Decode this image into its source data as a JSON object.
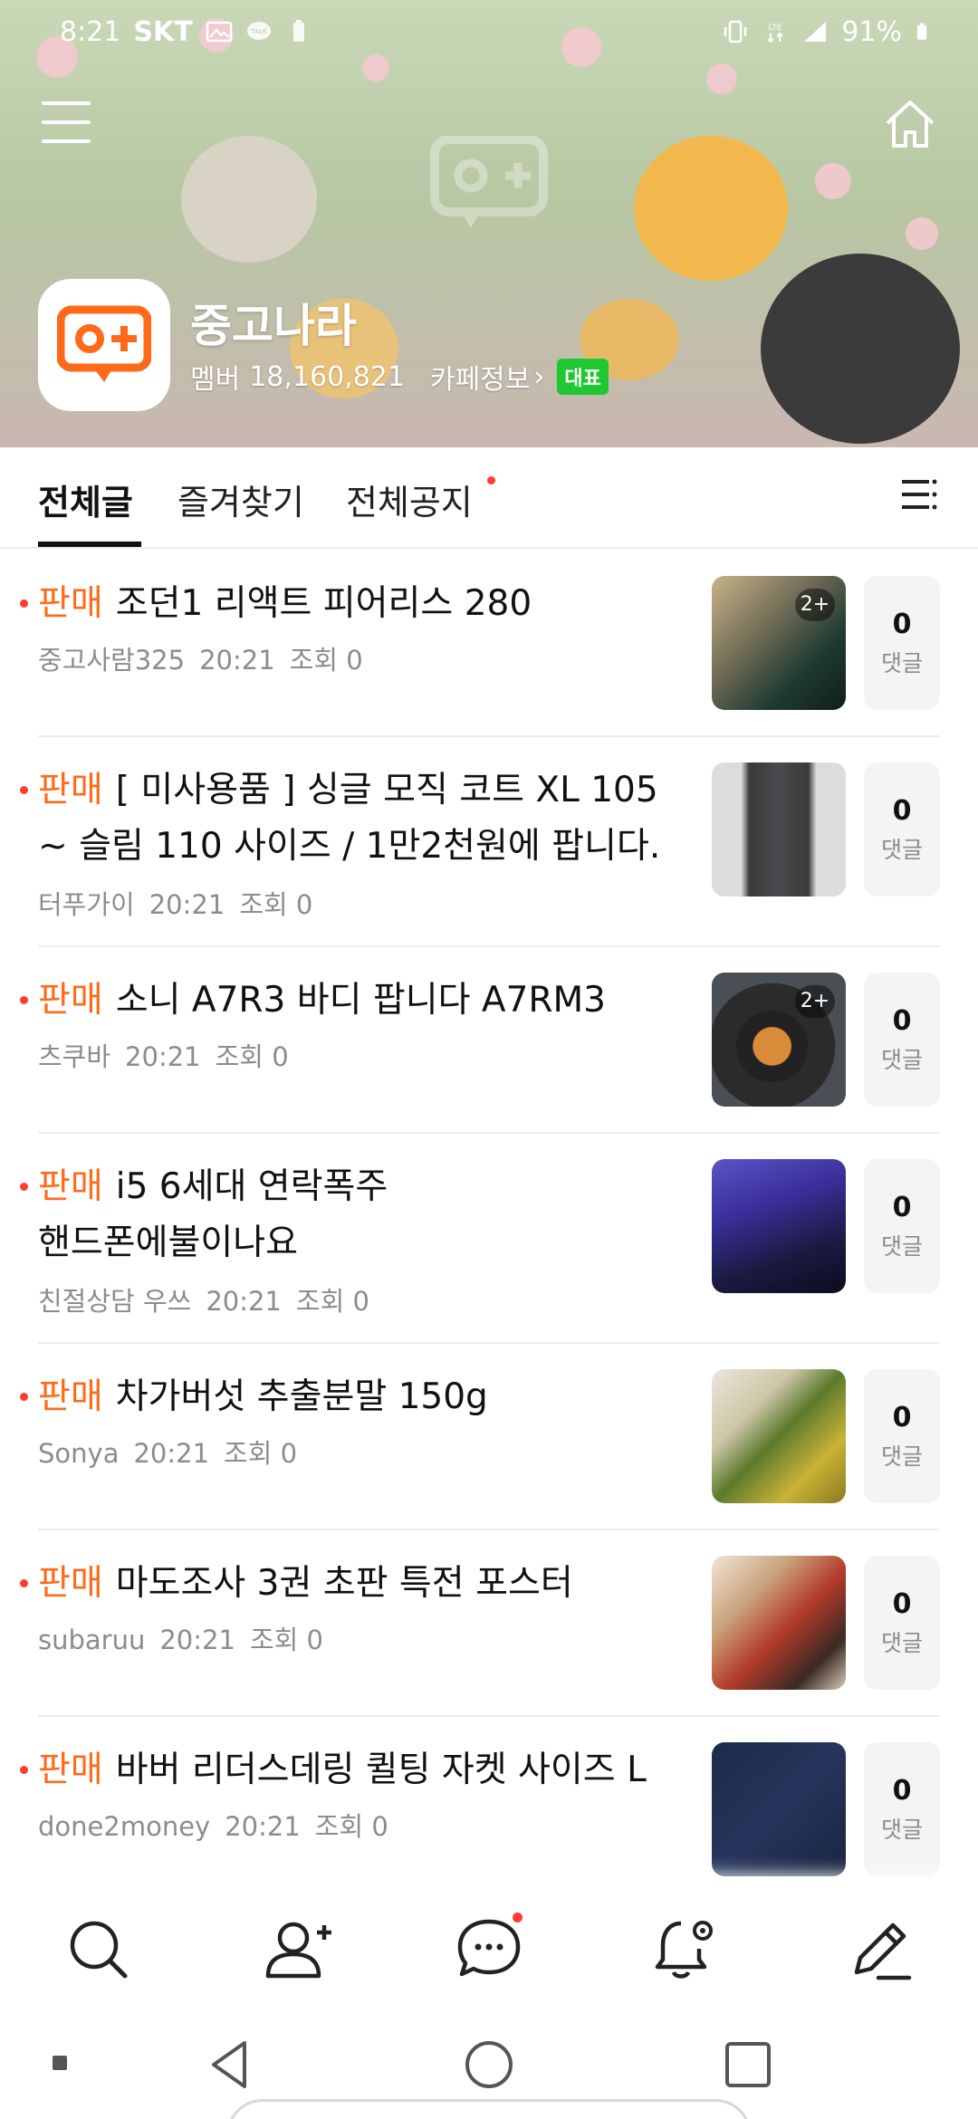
{
  "status_bar": {
    "time": "8:21",
    "carrier": "SKT",
    "battery": "91%",
    "network": "LTE",
    "talk_label": "TALK",
    "icons": [
      "gallery-icon",
      "kakaotalk-icon",
      "battery-saver-icon",
      "vibrate-icon",
      "lte-icon",
      "signal-icon",
      "battery-icon"
    ]
  },
  "header": {
    "menu_icon": "hamburger-menu-icon",
    "home_icon": "home-icon",
    "cafe_name": "중고나라",
    "member_label": "멤버",
    "member_count": "18,160,821",
    "cafe_info_label": "카페정보",
    "badge_label": "대표",
    "badge_color": "#1ec831",
    "accent_color": "#ff6a1a"
  },
  "tabs": {
    "items": [
      "전체글",
      "즐겨찾기",
      "전체공지"
    ],
    "active_index": 0,
    "list_icon": "list-view-icon"
  },
  "articles": [
    {
      "category": "판매",
      "title": "조던1 리액트 피어리스 280",
      "author": "중고사람325",
      "time": "20:21",
      "views": "조회 0",
      "image_badge": "2+",
      "comments": "0",
      "comment_label": "댓글"
    },
    {
      "category": "판매",
      "title": "[ 미사용품 ] 싱글 모직 코트 XL 105 ~ 슬림 110 사이즈 / 1만2천원에 팝니다.",
      "author": "터푸가이",
      "time": "20:21",
      "views": "조회 0",
      "image_badge": "",
      "comments": "0",
      "comment_label": "댓글"
    },
    {
      "category": "판매",
      "title": "소니 A7R3 바디 팝니다 A7RM3",
      "author": "츠쿠바",
      "time": "20:21",
      "views": "조회 0",
      "image_badge": "2+",
      "comments": "0",
      "comment_label": "댓글"
    },
    {
      "category": "판매",
      "title_line1": "i5 6세대 연락폭주",
      "title_line2": "핸드폰에불이나요",
      "author": "친절상담 우쓰",
      "time": "20:21",
      "views": "조회 0",
      "image_badge": "",
      "comments": "0",
      "comment_label": "댓글"
    },
    {
      "category": "판매",
      "title": "차가버섯 추출분말 150g",
      "author": "Sonya",
      "time": "20:21",
      "views": "조회 0",
      "image_badge": "",
      "comments": "0",
      "comment_label": "댓글"
    },
    {
      "category": "판매",
      "title": "마도조사 3권 초판 특전 포스터",
      "author": "subaruu",
      "time": "20:21",
      "views": "조회 0",
      "image_badge": "",
      "comments": "0",
      "comment_label": "댓글"
    },
    {
      "category": "판매",
      "title": "바버 리더스데링 퀼팅 자켓 사이즈 L",
      "author": "done2money",
      "time": "20:21",
      "views": "조회 0",
      "image_badge": "",
      "comments": "0",
      "comment_label": "댓글"
    }
  ],
  "bottom_nav": {
    "items": [
      "search-icon",
      "add-member-icon",
      "chat-icon",
      "notification-settings-icon",
      "write-icon"
    ]
  },
  "system_nav": {
    "items": [
      "recents-dot-icon",
      "back-icon",
      "home-circle-icon",
      "overview-square-icon"
    ]
  }
}
